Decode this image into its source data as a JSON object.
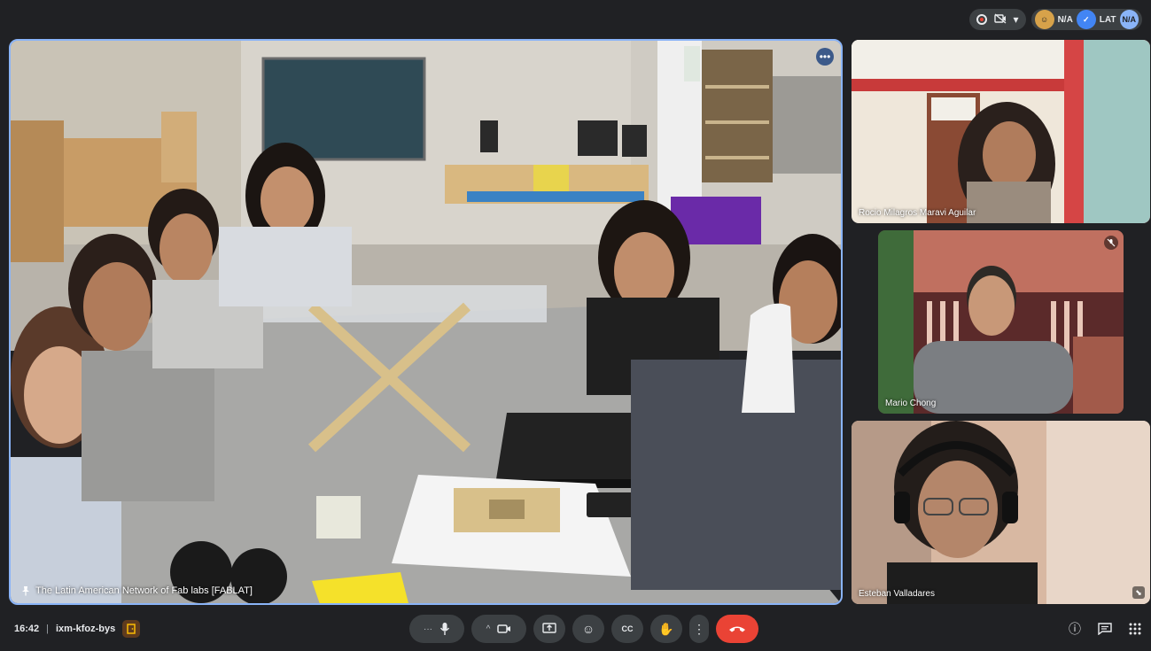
{
  "top_status": {
    "record_icon": "record-icon",
    "camera_off_icon": "camera-off-icon",
    "caret": "▾",
    "participants": [
      "N/A",
      "LAT",
      "N/A"
    ]
  },
  "main_tile": {
    "name": "The Latin American Network of Fab labs [FABLAT]",
    "pin_icon": "pin-icon",
    "more": "•••"
  },
  "side_tiles": [
    {
      "name": "Rocio Milagros Maravi Aguilar"
    },
    {
      "name": "Mario Chong"
    },
    {
      "name": "Esteban Valladares"
    }
  ],
  "meeting": {
    "time": "16:42",
    "separator": "|",
    "code": "ixm-kfoz-bys",
    "badge": "🚪"
  },
  "controls": {
    "more_dots": "···",
    "mic": "🎤",
    "caret": "^",
    "camera": "📹",
    "present": "⇪",
    "emoji": "☺",
    "captions": "CC",
    "hand": "✋",
    "options": "⋮",
    "end": "☎"
  },
  "right_tools": {
    "info": "ⓘ",
    "chat": "💬",
    "activities": "⠿"
  },
  "colors": {
    "background": "#202124",
    "active_border": "#8ab4f8",
    "end_call": "#ea4335",
    "control_bg": "#3c4043"
  }
}
